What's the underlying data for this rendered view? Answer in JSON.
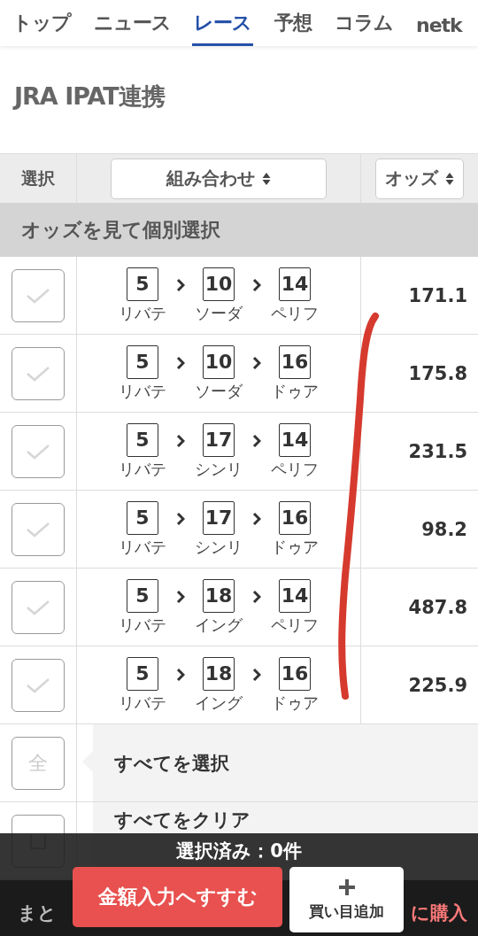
{
  "nav": {
    "tabs": [
      {
        "label": "トップ",
        "selected": false
      },
      {
        "label": "ニュース",
        "selected": false
      },
      {
        "label": "レース",
        "selected": true
      },
      {
        "label": "予想",
        "selected": false
      },
      {
        "label": "コラム",
        "selected": false
      },
      {
        "label": "netk",
        "selected": false
      }
    ]
  },
  "title": "JRA IPAT連携",
  "table": {
    "columns": [
      {
        "label": "選択",
        "sortable": false
      },
      {
        "label": "組み合わせ",
        "sortable": true
      },
      {
        "label": "オッズ",
        "sortable": true
      }
    ],
    "section": "オッズを見て個別選択",
    "rows": [
      {
        "checked": false,
        "horses": [
          {
            "number": "5",
            "name": "リバテ"
          },
          {
            "number": "10",
            "name": "ソーダ"
          },
          {
            "number": "14",
            "name": "ペリフ"
          }
        ],
        "odds": "171.1"
      },
      {
        "checked": false,
        "horses": [
          {
            "number": "5",
            "name": "リバテ"
          },
          {
            "number": "10",
            "name": "ソーダ"
          },
          {
            "number": "16",
            "name": "ドゥア"
          }
        ],
        "odds": "175.8"
      },
      {
        "checked": false,
        "horses": [
          {
            "number": "5",
            "name": "リバテ"
          },
          {
            "number": "17",
            "name": "シンリ"
          },
          {
            "number": "14",
            "name": "ペリフ"
          }
        ],
        "odds": "231.5"
      },
      {
        "checked": false,
        "horses": [
          {
            "number": "5",
            "name": "リバテ"
          },
          {
            "number": "17",
            "name": "シンリ"
          },
          {
            "number": "16",
            "name": "ドゥア"
          }
        ],
        "odds": "98.2"
      },
      {
        "checked": false,
        "horses": [
          {
            "number": "5",
            "name": "リバテ"
          },
          {
            "number": "18",
            "name": "イング"
          },
          {
            "number": "14",
            "name": "ペリフ"
          }
        ],
        "odds": "487.8"
      },
      {
        "checked": false,
        "horses": [
          {
            "number": "5",
            "name": "リバテ"
          },
          {
            "number": "18",
            "name": "イング"
          },
          {
            "number": "16",
            "name": "ドゥア"
          }
        ],
        "odds": "225.9"
      }
    ]
  },
  "bulk": [
    {
      "kind": "all",
      "checked": false,
      "mark": "全",
      "label": "すべてを選択"
    },
    {
      "kind": "clear",
      "checked": false,
      "label": "すべてをクリア"
    }
  ],
  "footer": {
    "count": "選択済み：0件",
    "primary_button": "金額入力へすすむ",
    "add_button": "買い目追加",
    "behind_left": "まと",
    "behind_right": "に購入"
  }
}
